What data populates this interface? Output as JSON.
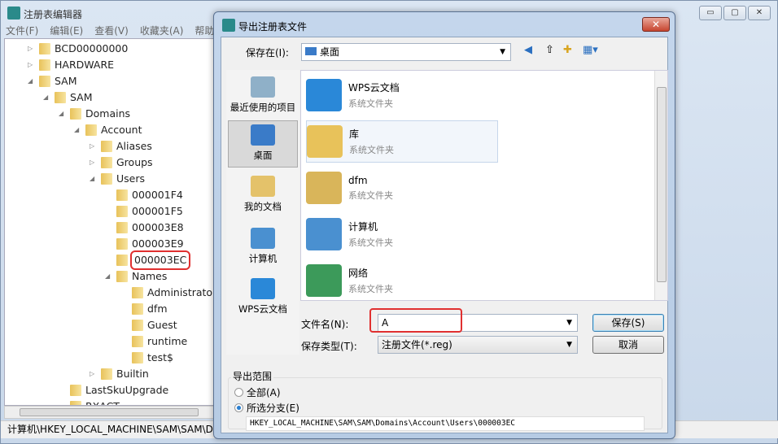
{
  "main_window": {
    "title": "注册表编辑器",
    "menu": [
      "文件(F)",
      "编辑(E)",
      "查看(V)",
      "收藏夹(A)",
      "帮助"
    ],
    "buttons": [
      "▭",
      "▢",
      "✕"
    ],
    "tree": [
      {
        "label": "BCD00000000",
        "level": 0,
        "state": "collapsed"
      },
      {
        "label": "HARDWARE",
        "level": 0,
        "state": "collapsed"
      },
      {
        "label": "SAM",
        "level": 0,
        "state": "expanded"
      },
      {
        "label": "SAM",
        "level": 1,
        "state": "expanded"
      },
      {
        "label": "Domains",
        "level": 2,
        "state": "expanded"
      },
      {
        "label": "Account",
        "level": 3,
        "state": "expanded"
      },
      {
        "label": "Aliases",
        "level": 4,
        "state": "collapsed"
      },
      {
        "label": "Groups",
        "level": 4,
        "state": "collapsed"
      },
      {
        "label": "Users",
        "level": 4,
        "state": "expanded"
      },
      {
        "label": "000001F4",
        "level": 5,
        "state": "leaf"
      },
      {
        "label": "000001F5",
        "level": 5,
        "state": "leaf"
      },
      {
        "label": "000003E8",
        "level": 5,
        "state": "leaf"
      },
      {
        "label": "000003E9",
        "level": 5,
        "state": "leaf"
      },
      {
        "label": "000003EC",
        "level": 5,
        "state": "leaf",
        "highlighted": true
      },
      {
        "label": "Names",
        "level": 5,
        "state": "expanded"
      },
      {
        "label": "Administrator",
        "level": 6,
        "state": "leaf"
      },
      {
        "label": "dfm",
        "level": 6,
        "state": "leaf"
      },
      {
        "label": "Guest",
        "level": 6,
        "state": "leaf"
      },
      {
        "label": "runtime",
        "level": 6,
        "state": "leaf"
      },
      {
        "label": "test$",
        "level": 6,
        "state": "leaf"
      },
      {
        "label": "Builtin",
        "level": 4,
        "state": "collapsed"
      },
      {
        "label": "LastSkuUpgrade",
        "level": 2,
        "state": "leaf"
      },
      {
        "label": "RXACT",
        "level": 2,
        "state": "leaf"
      }
    ],
    "status": "计算机\\HKEY_LOCAL_MACHINE\\SAM\\SAM\\D"
  },
  "dialog": {
    "title": "导出注册表文件",
    "close": "✕",
    "save_in_label": "保存在(I):",
    "save_in_value": "桌面",
    "places": [
      {
        "label": "最近使用的项目",
        "color": "#8fb0c8"
      },
      {
        "label": "桌面",
        "color": "#3a7bc8",
        "selected": true
      },
      {
        "label": "我的文档",
        "color": "#e4c26a"
      },
      {
        "label": "计算机",
        "color": "#4a90d0"
      },
      {
        "label": "WPS云文档",
        "color": "#2a88d8"
      }
    ],
    "files": [
      {
        "name": "WPS云文档",
        "type": "系统文件夹",
        "color": "#2a88d8"
      },
      {
        "name": "库",
        "type": "系统文件夹",
        "color": "#e8c25a",
        "selected": true
      },
      {
        "name": "dfm",
        "type": "系统文件夹",
        "color": "#d9b55a"
      },
      {
        "name": "计算机",
        "type": "系统文件夹",
        "color": "#4a90d0"
      },
      {
        "name": "网络",
        "type": "系统文件夹",
        "color": "#3c9a5a"
      }
    ],
    "filename_label": "文件名(N):",
    "filename_value": "A",
    "filetype_label": "保存类型(T):",
    "filetype_value": "注册文件(*.reg)",
    "save_button": "保存(S)",
    "cancel_button": "取消",
    "export_range": {
      "title": "导出范围",
      "all": "全部(A)",
      "selected": "所选分支(E)",
      "selected_checked": true,
      "path": "HKEY_LOCAL_MACHINE\\SAM\\SAM\\Domains\\Account\\Users\\000003EC"
    }
  },
  "colors": {
    "highlight": "#e03030",
    "accent": "#3c7fb1"
  }
}
